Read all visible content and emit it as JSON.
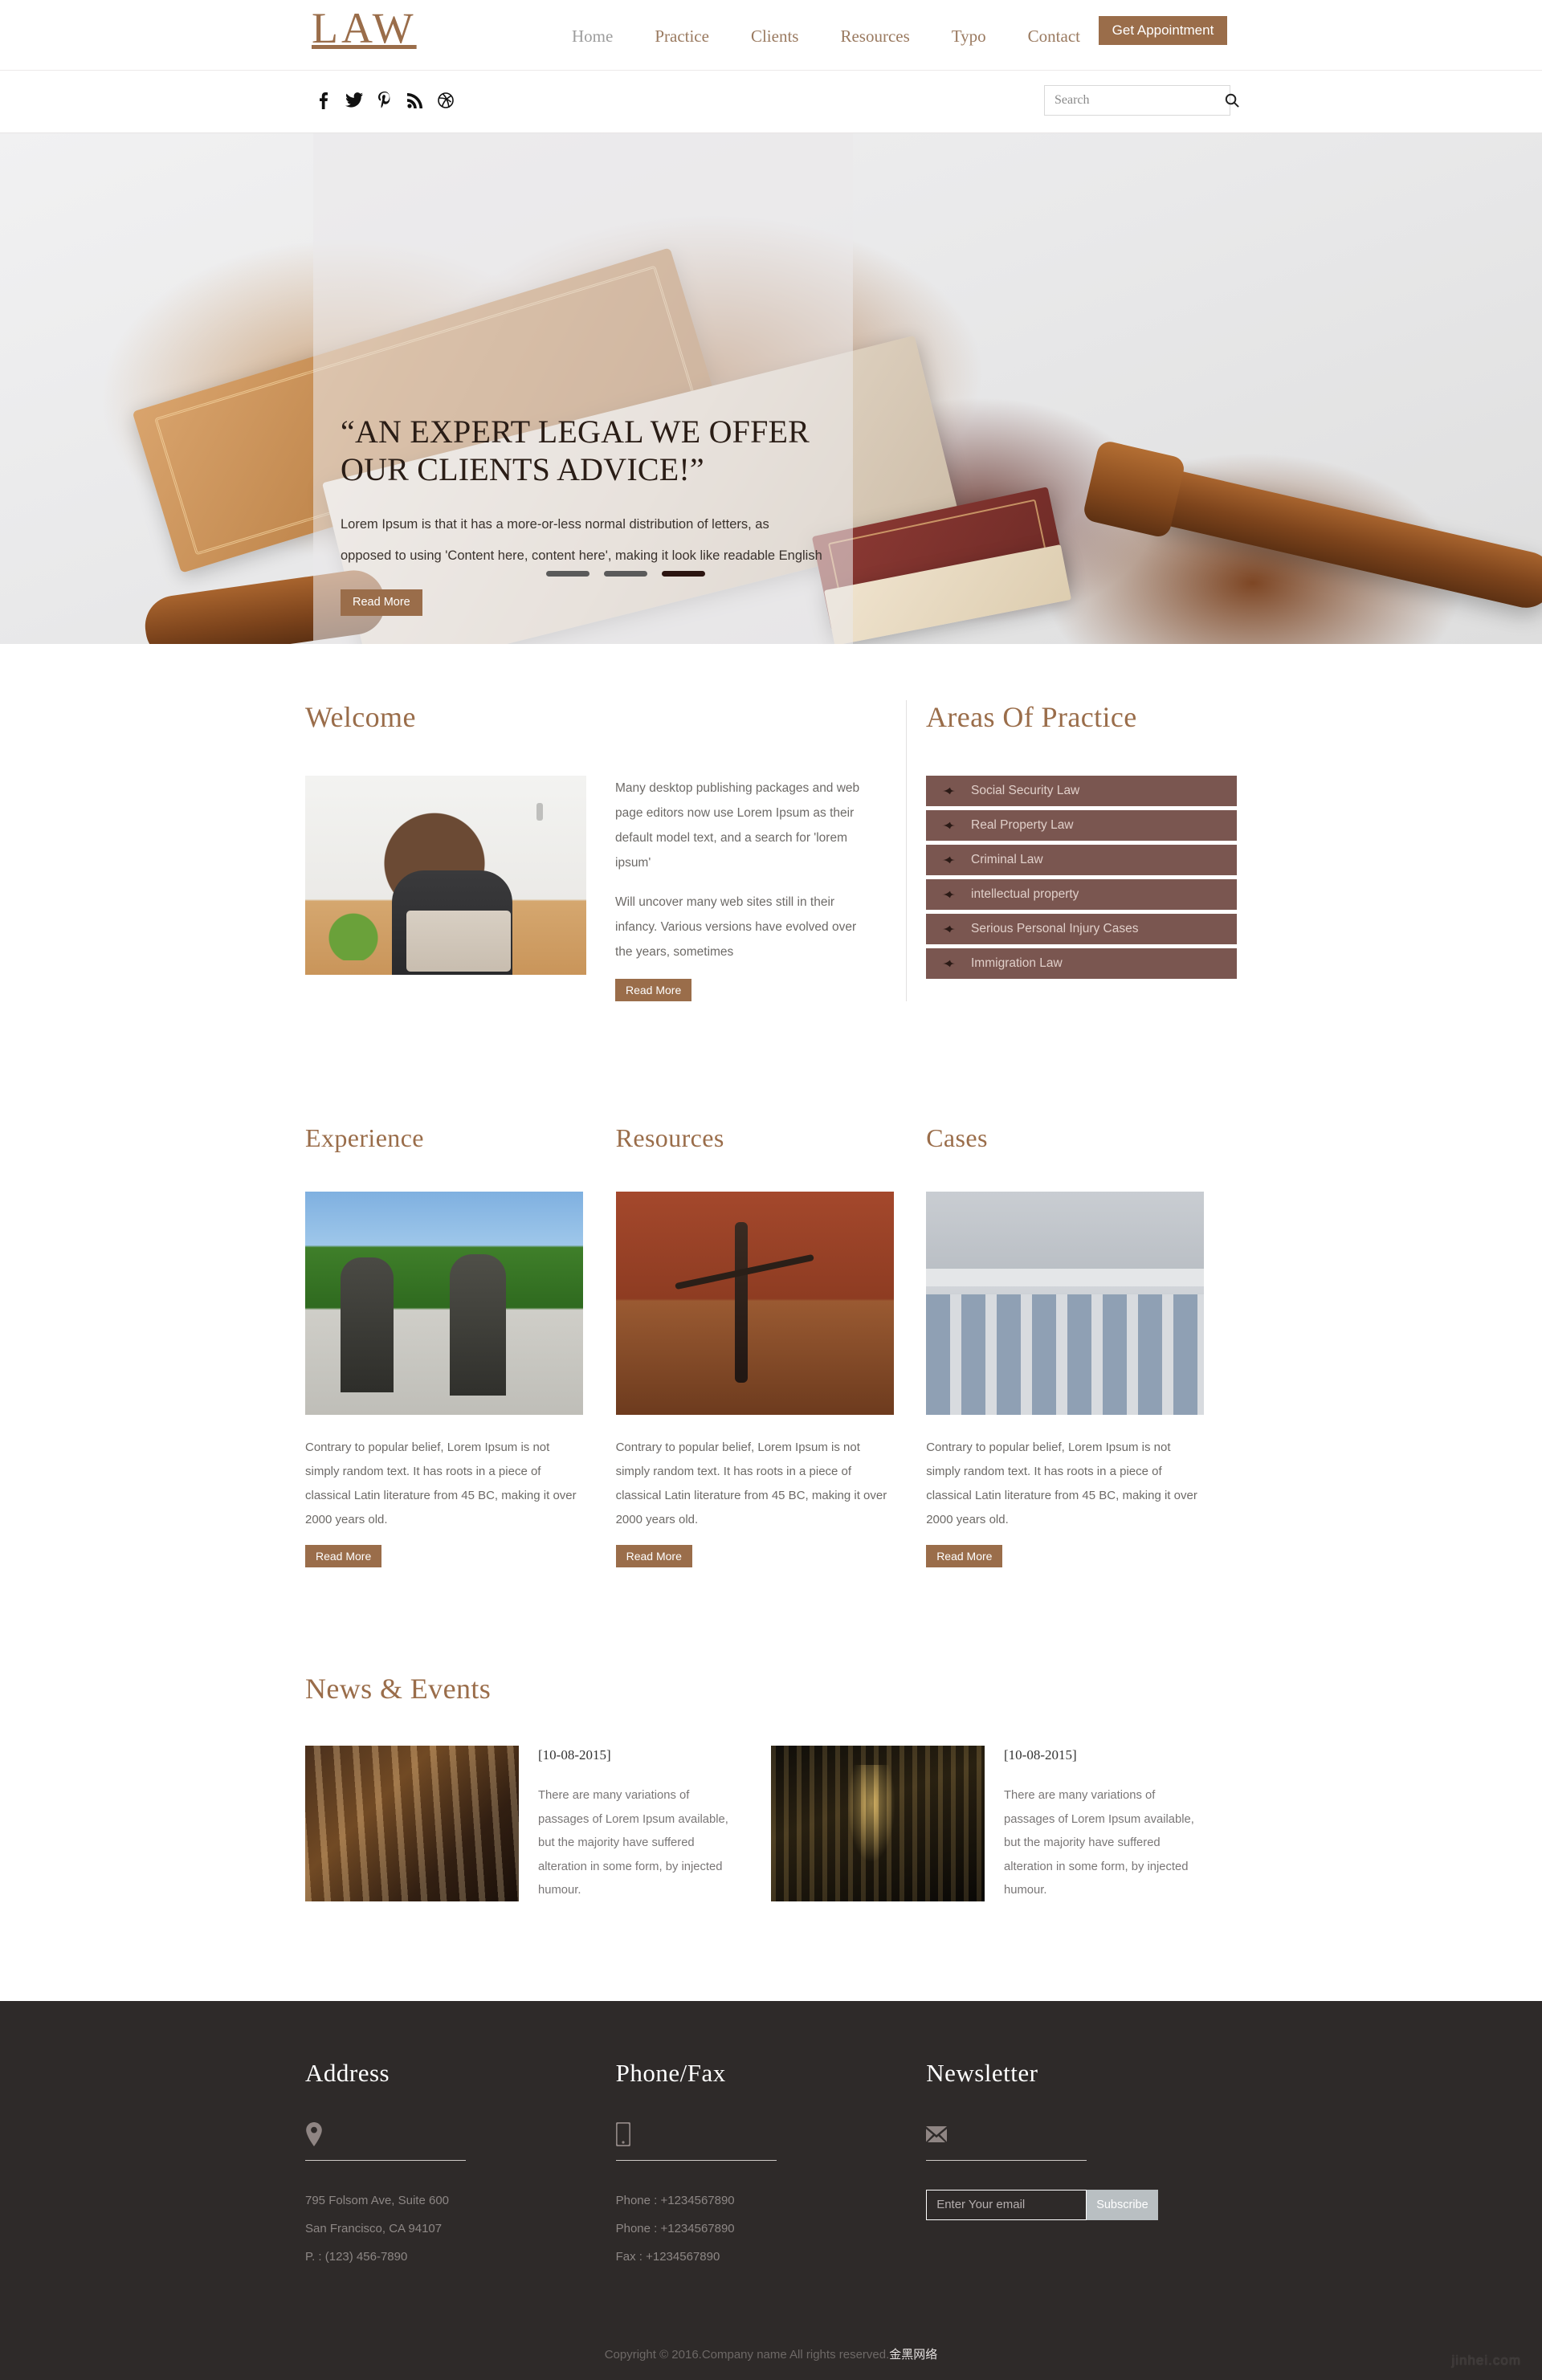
{
  "brand": {
    "logo": "LAW"
  },
  "colors": {
    "accent": "#9a6d4a",
    "practice_bg": "#7a5650",
    "footer_bg": "#2e2a29",
    "nav_link": "#9a7a60",
    "nav_active": "#9d9d9d",
    "subscribe_bg": "#b9bfc2"
  },
  "nav": {
    "items": [
      {
        "label": "Home",
        "active": true
      },
      {
        "label": "Practice",
        "active": false
      },
      {
        "label": "Clients",
        "active": false
      },
      {
        "label": "Resources",
        "active": false
      },
      {
        "label": "Typo",
        "active": false
      },
      {
        "label": "Contact",
        "active": false
      }
    ],
    "appointment_button": "Get Appointment"
  },
  "social": {
    "items": [
      {
        "name": "facebook-icon"
      },
      {
        "name": "twitter-icon"
      },
      {
        "name": "pinterest-icon"
      },
      {
        "name": "rss-icon"
      },
      {
        "name": "dribbble-icon"
      }
    ]
  },
  "search": {
    "placeholder": "Search",
    "value": "",
    "icon": "search-icon"
  },
  "hero": {
    "title": "“AN EXPERT LEGAL WE OFFER OUR CLIENTS ADVICE!”",
    "description": "Lorem Ipsum is that it has a more-or-less normal distribution of letters, as opposed to using 'Content here, content here', making it look like readable English",
    "button": "Read More",
    "slides": [
      {
        "active": false
      },
      {
        "active": false
      },
      {
        "active": true
      }
    ]
  },
  "welcome": {
    "title": "Welcome",
    "image_alt": "man-at-laptop-photo",
    "paragraphs": [
      "Many desktop publishing packages and web page editors now use Lorem Ipsum as their default model text, and a search for 'lorem ipsum'",
      "Will uncover many web sites still in their infancy. Various versions have evolved over the years, sometimes"
    ],
    "button": "Read More"
  },
  "practice": {
    "title": "Areas Of Practice",
    "items": [
      "Social Security Law",
      "Real Property Law",
      "Criminal Law",
      "intellectual property",
      "Serious Personal Injury Cases",
      "Immigration Law"
    ]
  },
  "three_columns": [
    {
      "title": "Experience",
      "image_alt": "bronze-statues-photo",
      "text": "Contrary to popular belief, Lorem Ipsum is not simply random text. It has roots in a piece of classical Latin literature from 45 BC, making it over 2000 years old.",
      "button": "Read More"
    },
    {
      "title": "Resources",
      "image_alt": "scales-of-justice-photo",
      "text": "Contrary to popular belief, Lorem Ipsum is not simply random text. It has roots in a piece of classical Latin literature from 45 BC, making it over 2000 years old.",
      "button": "Read More"
    },
    {
      "title": "Cases",
      "image_alt": "courthouse-building-photo",
      "text": "Contrary to popular belief, Lorem Ipsum is not simply random text. It has roots in a piece of classical Latin literature from 45 BC, making it over 2000 years old.",
      "button": "Read More"
    }
  ],
  "news": {
    "title": "News & Events",
    "items": [
      {
        "date": "[10-08-2015]",
        "image_alt": "old-books-photo",
        "text": "There are many variations of passages of Lorem Ipsum available, but the majority have suffered alteration in some form, by injected humour."
      },
      {
        "date": "[10-08-2015]",
        "image_alt": "library-fairy-photo",
        "text": "There are many variations of passages of Lorem Ipsum available, but the majority have suffered alteration in some form, by injected humour."
      }
    ]
  },
  "footer": {
    "address": {
      "title": "Address",
      "icon": "map-pin-icon",
      "line1": "795 Folsom Ave, Suite 600",
      "line2": "San Francisco, CA 94107",
      "line3": "P. : (123) 456-7890"
    },
    "phone": {
      "title": "Phone/Fax",
      "icon": "mobile-phone-icon",
      "line1": "Phone : +1234567890",
      "line2": "Phone : +1234567890",
      "line3": "Fax : +1234567890"
    },
    "newsletter": {
      "title": "Newsletter",
      "icon": "envelope-icon",
      "placeholder": "Enter Your email",
      "value": "",
      "button": "Subscribe"
    },
    "copyright_main": "Copyright © 2016.Company name All rights reserved.",
    "copyright_cn": "金黑网络",
    "watermark": "jinhei.com"
  }
}
